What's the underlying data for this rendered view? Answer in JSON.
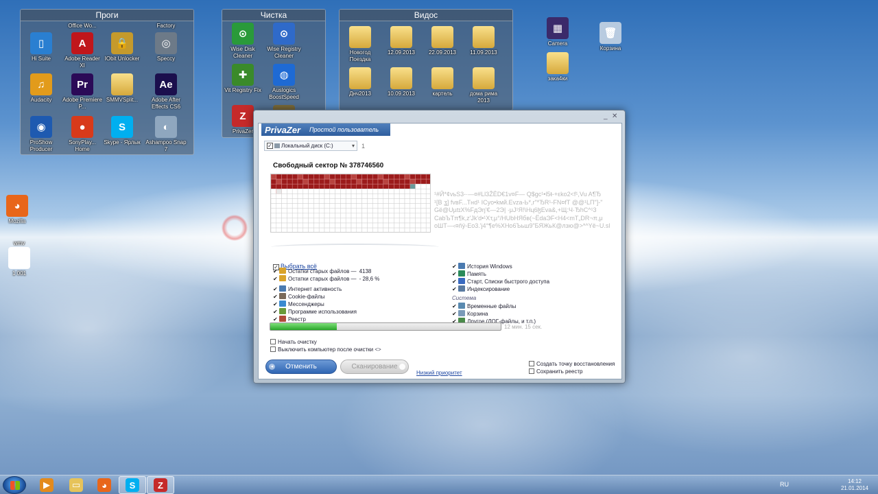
{
  "fences": [
    {
      "title": "Проги",
      "items": [
        {
          "label": "Office Wo...",
          "color": "#d04f2a",
          "glyph": ""
        },
        {
          "label": "Factory",
          "color": "#5a6a7a",
          "glyph": ""
        },
        {
          "label": "Hi Suite",
          "color": "#2a7fd1",
          "glyph": "▯"
        },
        {
          "label": "Adobe Reader XI",
          "color": "#c0161b",
          "glyph": "A"
        },
        {
          "label": "IObit Unlocker",
          "color": "#c59a2c",
          "glyph": "🔒"
        },
        {
          "label": "Speccy",
          "color": "#6d7a88",
          "glyph": "◎"
        },
        {
          "label": "Audacity",
          "color": "#e29b1b",
          "glyph": "♫"
        },
        {
          "label": "Adobe Premiere P...",
          "color": "#2b0a57",
          "glyph": "Pr"
        },
        {
          "label": "SMMVSplit...",
          "color": "#e7c45e",
          "glyph": ""
        },
        {
          "label": "Adobe After Effects CS6",
          "color": "#1b0f4d",
          "glyph": "Ae"
        },
        {
          "label": "ProShow Producer",
          "color": "#1e5ab0",
          "glyph": "◉"
        },
        {
          "label": "SonyPlay... Home",
          "color": "#d83a1a",
          "glyph": "●"
        },
        {
          "label": "Skype - Ярлык",
          "color": "#00aff0",
          "glyph": "S"
        },
        {
          "label": "Ashampoo Snap 7",
          "color": "#8fa7bf",
          "glyph": "◐"
        }
      ]
    },
    {
      "title": "Чистка",
      "items": [
        {
          "label": "Wise Disk Cleaner",
          "color": "#2a9a3a",
          "glyph": "⊙"
        },
        {
          "label": "Wise Registry Cleaner",
          "color": "#2f6ac9",
          "glyph": "⊙"
        },
        {
          "label": "Vit Registry Fix",
          "color": "#3a8a2a",
          "glyph": "✚"
        },
        {
          "label": "Auslogics BoostSpeed",
          "color": "#1e6ad4",
          "glyph": "◍"
        },
        {
          "label": "PrivaZer",
          "color": "#c52a2a",
          "glyph": "Z"
        },
        {
          "label": "",
          "color": "#7a6a3a",
          "glyph": "▤"
        }
      ]
    },
    {
      "title": "Видос",
      "items": [
        {
          "label": "Новогод Поездка"
        },
        {
          "label": "12.09.2013"
        },
        {
          "label": "22.09.2013"
        },
        {
          "label": "11.09.2013"
        },
        {
          "label": "Днч2013"
        },
        {
          "label": "10.09.2013"
        },
        {
          "label": "картель"
        },
        {
          "label": "дома рима 2013"
        }
      ]
    }
  ],
  "desktop_icons": [
    {
      "label": "Camera",
      "color": "#3b2a6a",
      "glyph": "▦"
    },
    {
      "label": "Корзина",
      "color": "#b8cbe0",
      "glyph": "🗑"
    },
    {
      "label": "зака4ки",
      "color": "#e8b640",
      "glyph": ""
    },
    {
      "label": "Mozilla",
      "color": "#e8661a",
      "glyph": "◕"
    },
    {
      "label": "1 001",
      "color": "#ffffff",
      "glyph": "▤",
      "top_label": "wmv"
    }
  ],
  "privazer": {
    "brand": "PrivaZer",
    "mode": "Простой пользователь",
    "drive_label": "Локальный диск (C:)",
    "drive_count": "1",
    "sector_title": "Свободный сектор № 378746560",
    "gibberish": [
      "¹#Й*¢vьS3-·—¤#Ll3ŽЁD€1v¤F— Q$gc¹•l5ŧ-+εkо2<f¹,Vu A¶Ђ",
      "¹[B ʓ] fvвF...Тнd¹ ICyo•kмй.Evza-Ь*,r\"*ЂR¹-FN¤fT @@¹LП\"]-\"",
      "Gë@UµtɪX%FдЭŋ'€—2Э| ·μJ¹Я!\\Hц6ɮЕva&,+Щ:Ч·ЂhC^¹3",
      "CabЪTπ¶k,z'Jk'd•¹Xт,μ°/НUbНЯбв(~ЁdaЭF<Н4<mТ„DR¬π,μ",
      "oШT—‹¤ňÿ-Eo3.'j4°¶e%XHo6Ъьш9\"БЯЖьК@лзю@>*^Yё~U.sl"
    ],
    "select_all": "Выбрать всё",
    "left_options": [
      {
        "label": "Остатки старых файлов —",
        "value": "4138",
        "color": "#d9a32a"
      },
      {
        "label": "Остатки старых файлов —",
        "value": "- 28,6 %",
        "color": "#d9a32a"
      },
      {
        "label": "Интернет активность",
        "value": "",
        "color": "#4a7ab0"
      },
      {
        "label": "Cookie-файлы",
        "value": "",
        "color": "#7a6a5a"
      },
      {
        "label": "Мессенджеры",
        "value": "",
        "color": "#3a8ad0"
      },
      {
        "label": "Программе использования",
        "value": "",
        "color": "#6a9a3a"
      },
      {
        "label": "Реестр",
        "value": "",
        "color": "#b04a3a"
      }
    ],
    "right_options": [
      {
        "label": "История Windows",
        "color": "#4a7ab0"
      },
      {
        "label": "Память",
        "color": "#2a8a5a"
      },
      {
        "label": "Старт, Списки быстрого доступа",
        "color": "#3a6ac0"
      },
      {
        "label": "Индексирование",
        "color": "#5a7aa0"
      }
    ],
    "system_header": "Система",
    "system_options": [
      {
        "label": "Временные файлы",
        "color": "#5a8ab0"
      },
      {
        "label": "Корзина",
        "color": "#7a9ab8"
      },
      {
        "label": "Другое (ЛОГ-файлы, и т.п.)",
        "color": "#4a8a4a"
      }
    ],
    "progress": 0.29,
    "progress_time": "12 мин. 15 сек.",
    "cb_start_clean": "Начать очистку",
    "cb_shutdown": "Выключить компьютер после очистки",
    "btn_cancel": "Отменить",
    "btn_scan": "Сканирование",
    "low_priority": "Низкий приоритет",
    "cb_restore_point": "Создать точку восстановления",
    "cb_save_registry": "Сохранить реестр",
    "colors": {
      "accent": "#2f66b3",
      "sector_used": "#9c1b1b",
      "progress": "#2aa62a"
    }
  },
  "taskbar": {
    "apps": [
      {
        "name": "media-player",
        "color": "#e38a1c",
        "glyph": "▶"
      },
      {
        "name": "explorer",
        "color": "#e6c35a",
        "glyph": "▭"
      },
      {
        "name": "firefox",
        "color": "#e8661a",
        "glyph": "◕"
      },
      {
        "name": "skype",
        "color": "#00aff0",
        "glyph": "S"
      },
      {
        "name": "privazer",
        "color": "#c52a2a",
        "glyph": "Z"
      }
    ],
    "lang": "RU",
    "time": "14:12",
    "date": "21.01.2014"
  }
}
